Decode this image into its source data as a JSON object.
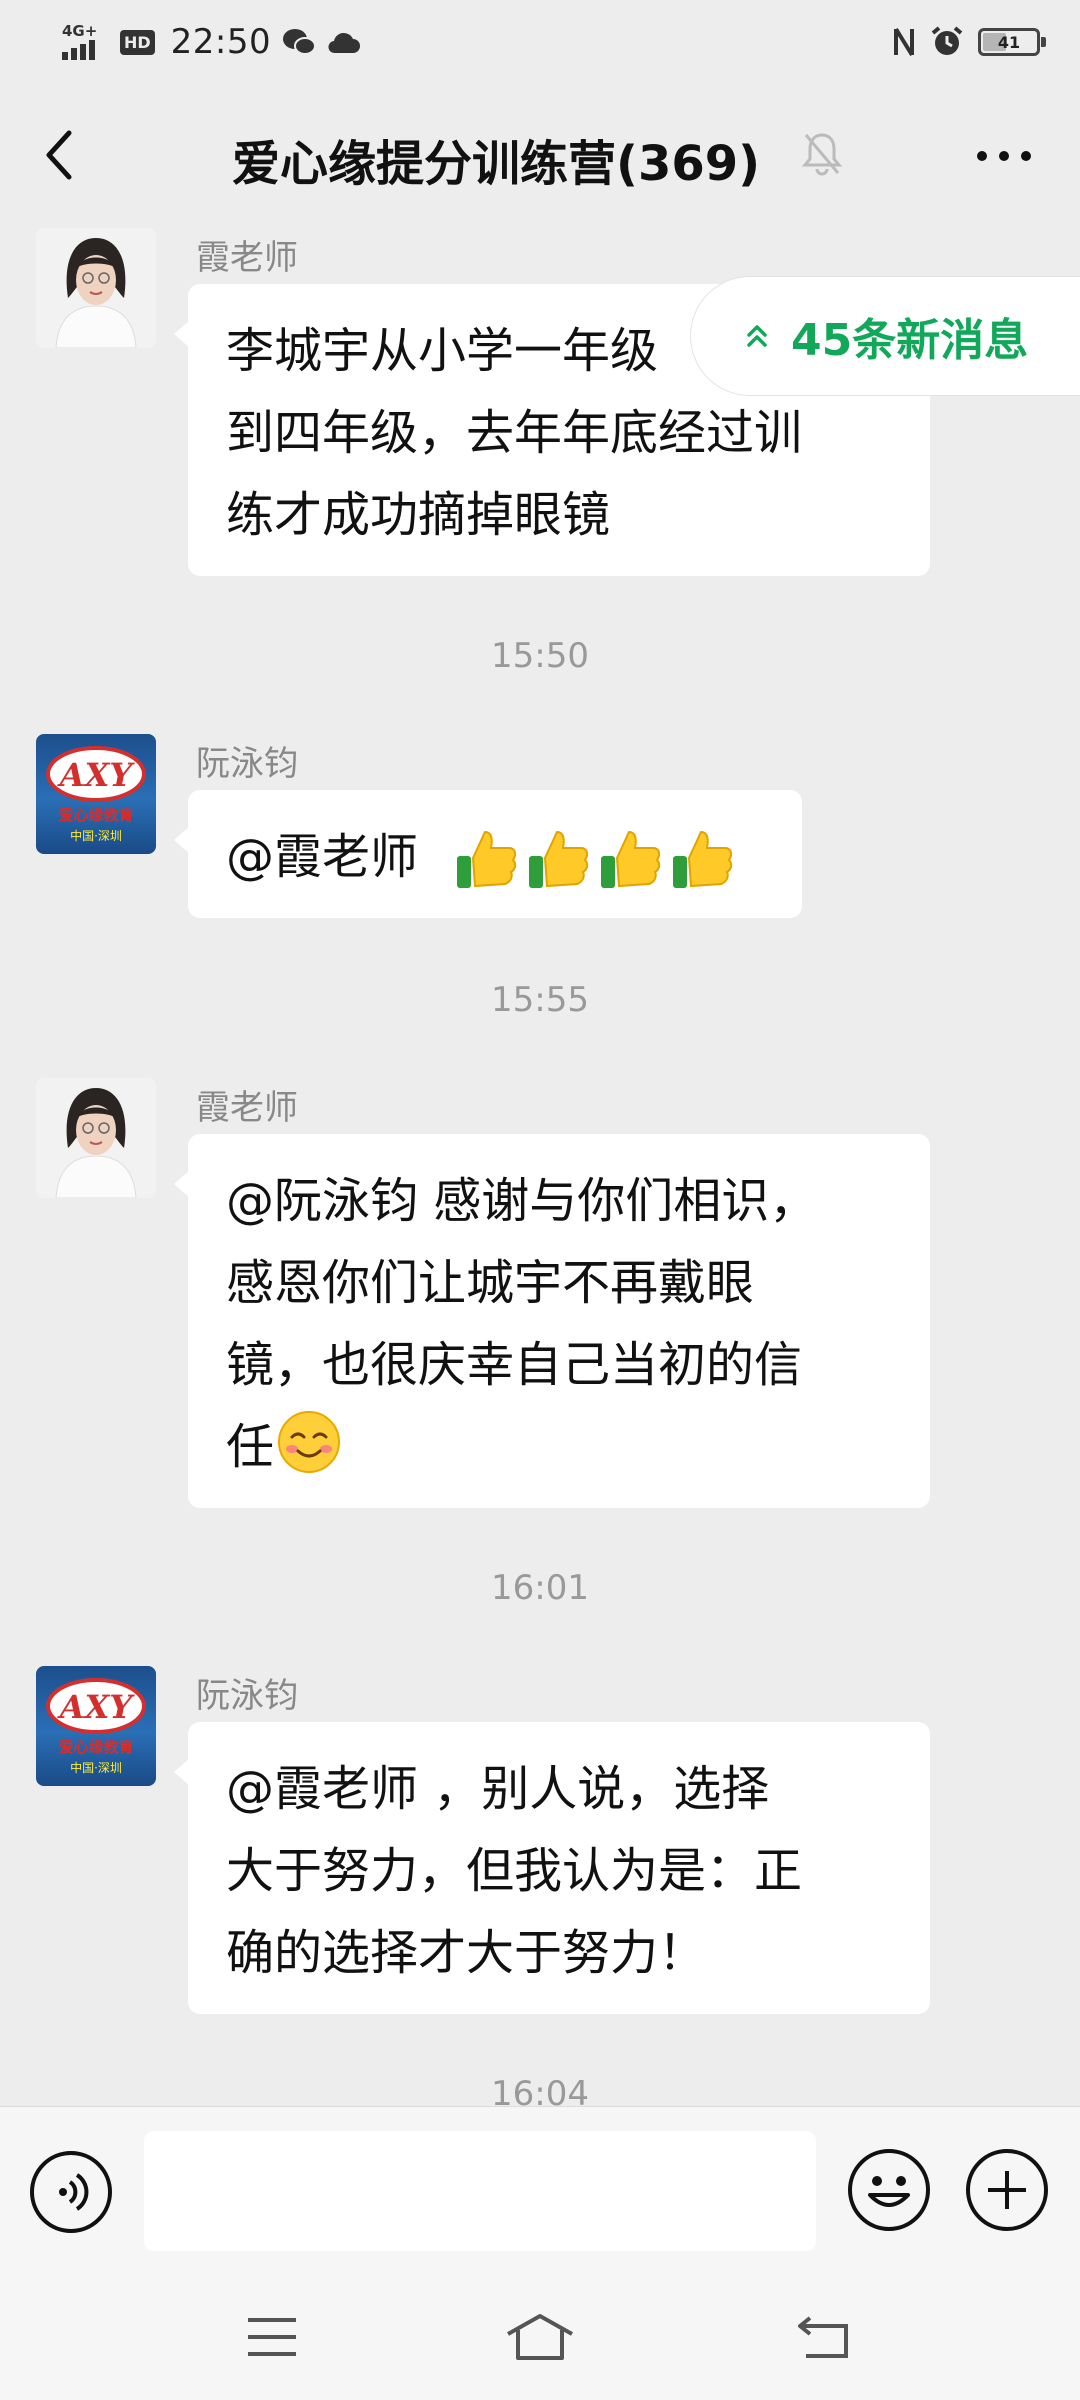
{
  "status_bar": {
    "network": "4G+",
    "hd": "HD",
    "time": "22:50",
    "battery": "41",
    "battery_level": 0.41
  },
  "header": {
    "title": "爱心缘提分训练营(369)",
    "icons": [
      "back-icon",
      "mute-bell-icon",
      "more-icon"
    ]
  },
  "new_messages": {
    "label": "45条新消息"
  },
  "messages": [
    {
      "type": "message",
      "sender": "霞老师",
      "avatar": "woman-portrait",
      "lines": [
        "李城宇从小学一年级",
        "到四年级，去年年底经过训",
        "练才成功摘掉眼镜"
      ]
    },
    {
      "type": "time",
      "text": "15:50"
    },
    {
      "type": "message",
      "sender": "阮泳钧",
      "avatar": "axy-logo",
      "lines": [
        "@霞老师"
      ],
      "emoji": [
        "thumbs-up",
        "thumbs-up",
        "thumbs-up",
        "thumbs-up"
      ]
    },
    {
      "type": "time",
      "text": "15:55"
    },
    {
      "type": "message",
      "sender": "霞老师",
      "avatar": "woman-portrait",
      "lines": [
        "@阮泳钧  感谢与你们相识，",
        "感恩你们让城宇不再戴眼",
        "镜，也很庆幸自己当初的信",
        "任"
      ],
      "emoji": [
        "smiling-face"
      ]
    },
    {
      "type": "time",
      "text": "16:01"
    },
    {
      "type": "message",
      "sender": "阮泳钧",
      "avatar": "axy-logo",
      "lines": [
        "@霞老师 ，别人说，选择",
        "大于努力，但我认为是：正",
        "确的选择才大于努力！"
      ]
    },
    {
      "type": "time",
      "text": "16:04"
    }
  ],
  "avatar_logo": {
    "brand": "AXY",
    "name": "爱心缘教育",
    "place": "中国·深圳"
  },
  "input_bar": {
    "placeholder": "",
    "icons": [
      "voice-icon",
      "emoji-icon",
      "plus-icon"
    ]
  },
  "nav_bar": {
    "icons": [
      "menu-icon",
      "home-icon",
      "back-nav-icon"
    ]
  },
  "colors": {
    "background": "#ededed",
    "bubble": "#ffffff",
    "accent_green": "#12a85a",
    "meta_text": "#999999"
  }
}
